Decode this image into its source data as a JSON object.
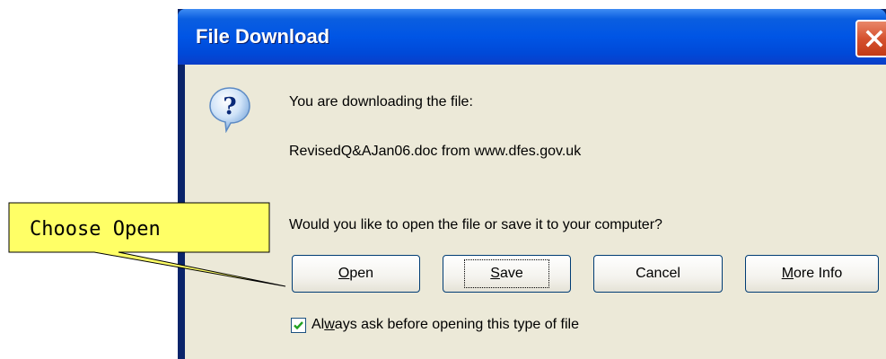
{
  "window": {
    "title": "File Download"
  },
  "dialog": {
    "line1": "You are downloading the file:",
    "file_info": "RevisedQ&AJan06.doc from www.dfes.gov.uk",
    "question": "Would you like to open the file or save it to your computer?",
    "buttons": {
      "open": {
        "accel": "O",
        "rest": "pen"
      },
      "save": {
        "accel": "S",
        "rest": "ave"
      },
      "cancel": "Cancel",
      "more_info": {
        "accel": "M",
        "rest": "ore Info"
      }
    },
    "checkbox": {
      "checked": true,
      "pre": "Al",
      "accel": "w",
      "post": "ays ask before opening this type of file"
    }
  },
  "callout": {
    "text": "Choose Open",
    "fill": "#ffff66"
  }
}
